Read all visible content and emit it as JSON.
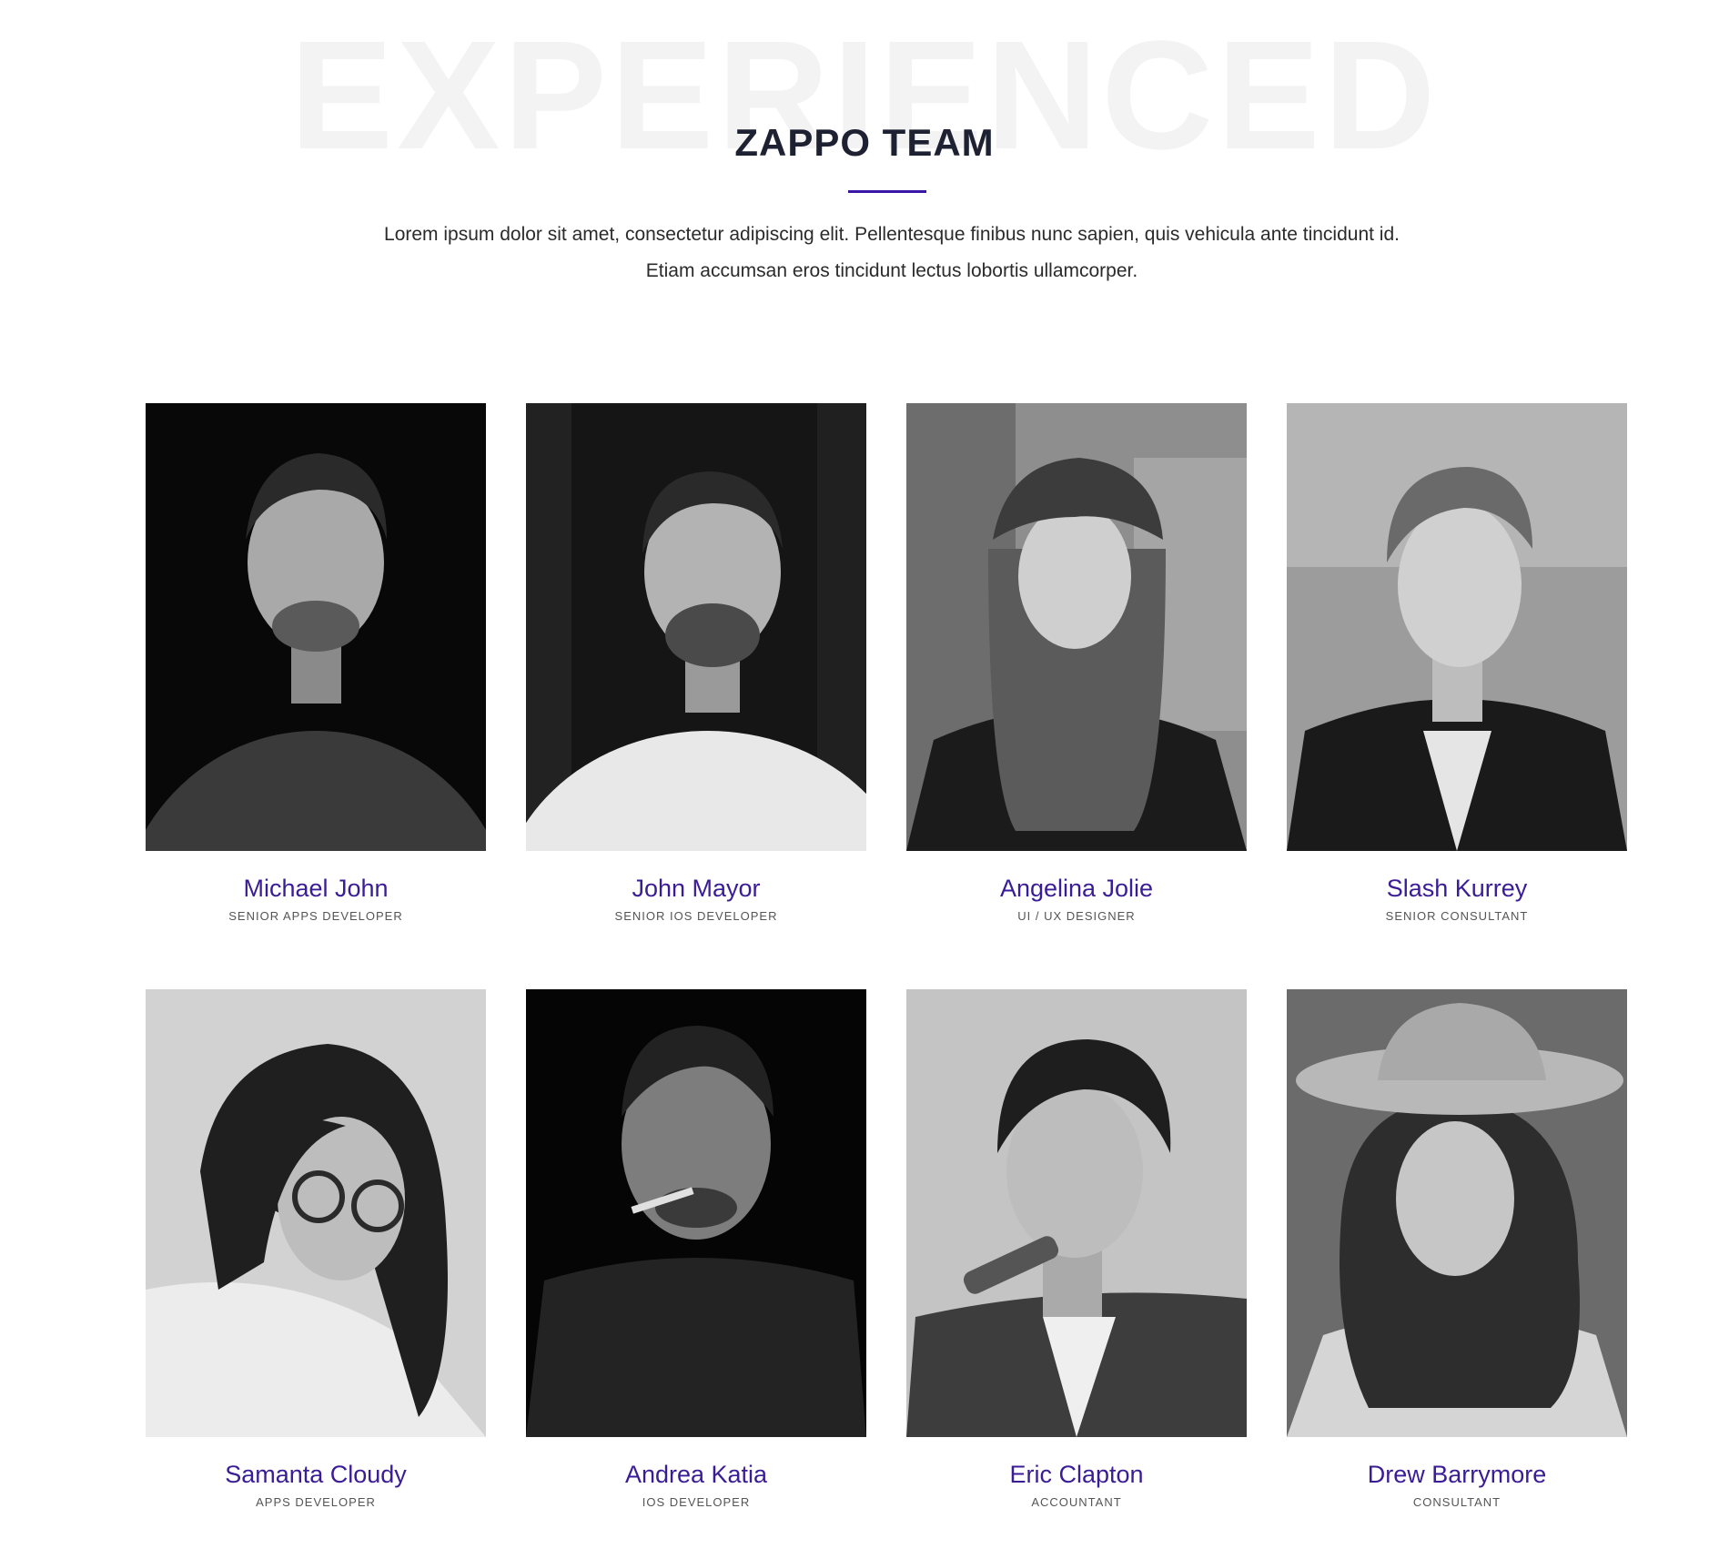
{
  "section": {
    "background_word": "EXPERIENCED",
    "title": "ZAPPO TEAM",
    "intro": "Lorem ipsum dolor sit amet, consectetur adipiscing elit. Pellentesque finibus nunc sapien, quis vehicula ante tincidunt id. Etiam accumsan eros tincidunt lectus lobortis ullamcorper."
  },
  "colors": {
    "accent": "#3a16a6",
    "name": "#3a1c96",
    "title": "#1e2132"
  },
  "team": [
    {
      "name": "Michael John",
      "role": "SENIOR APPS DEVELOPER"
    },
    {
      "name": "John Mayor",
      "role": "SENIOR IOS DEVELOPER"
    },
    {
      "name": "Angelina Jolie",
      "role": "UI / UX DESIGNER"
    },
    {
      "name": "Slash Kurrey",
      "role": "SENIOR CONSULTANT"
    },
    {
      "name": "Samanta Cloudy",
      "role": "APPS DEVELOPER"
    },
    {
      "name": "Andrea Katia",
      "role": "IOS DEVELOPER"
    },
    {
      "name": "Eric Clapton",
      "role": "ACCOUNTANT"
    },
    {
      "name": "Drew Barrymore",
      "role": "CONSULTANT"
    }
  ]
}
